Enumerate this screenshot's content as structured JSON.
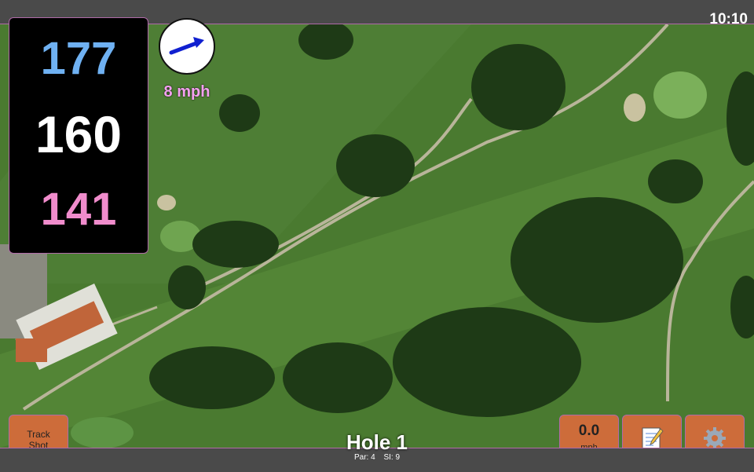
{
  "status_bar": {
    "time": "10:10"
  },
  "distances": {
    "back": "177",
    "middle": "160",
    "front": "141"
  },
  "wind": {
    "speed": "8 mph",
    "direction_icon": "wind-arrow-icon"
  },
  "buttons": {
    "track_shot_line1": "Track",
    "track_shot_line2": "Shot",
    "speed_value": "0.0",
    "speed_unit": "mph",
    "notes_icon": "notepad-icon",
    "settings_icon": "gear-icon"
  },
  "hole": {
    "title": "Hole 1",
    "par": "Par: 4",
    "si": "SI: 9"
  },
  "colors": {
    "back_distance": "#6fb1f2",
    "middle_distance": "#ffffff",
    "front_distance": "#f08ccc",
    "button_bg": "#cd6c3a",
    "accent_border": "#b06aa8"
  }
}
